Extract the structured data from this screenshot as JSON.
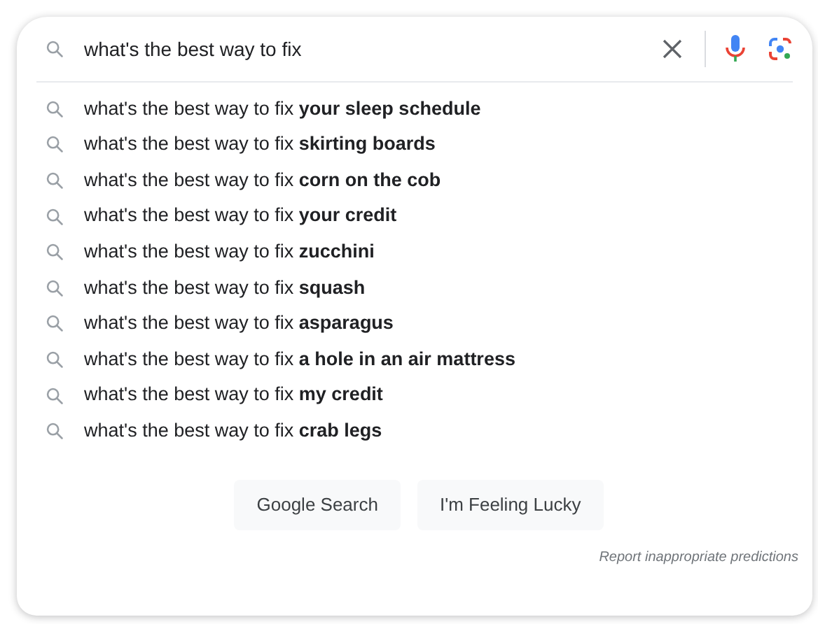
{
  "search": {
    "value": "what's the best way to fix"
  },
  "suggestions": [
    "what's the best way to fix **your sleep schedule**",
    "what's the best way to fix **skirting boards**",
    "what's the best way to fix **corn on the cob**",
    "what's the best way to fix **your credit**",
    "what's the best way to fix **zucchini**",
    "what's the best way to fix **squash**",
    "what's the best way to fix **asparagus**",
    "what's the best way to fix **a hole in an air mattress**",
    "what's the best way to fix **my credit**",
    "what's the best way to fix **crab legs**"
  ],
  "buttons": [
    "Google Search",
    "I'm Feeling Lucky"
  ],
  "report_link": "Report inappropriate predictions"
}
